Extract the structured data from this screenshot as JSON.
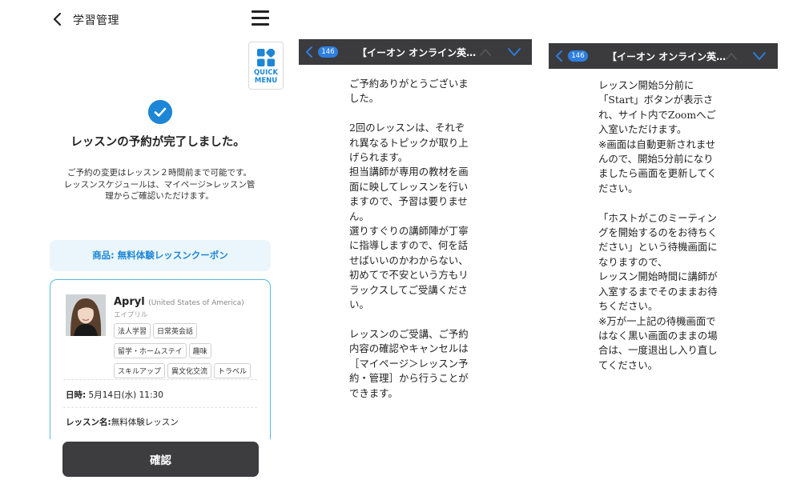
{
  "panel1": {
    "header": {
      "title": "学習管理"
    },
    "quick_menu": {
      "label_line1": "QUICK",
      "label_line2": "MENU"
    },
    "heading": "レッスンの予約が完了しました。",
    "notice_line1": "ご予約の変更はレッスン２時間前まで可能です。",
    "notice_line2": "レッスンスケジュールは、マイページ>レッスン管",
    "notice_line3": "理からご確認いただけます。",
    "coupon": "商品: 無料体験レッスンクーポン",
    "teacher": {
      "name": "Apryl",
      "country": "(United States of America)",
      "kana": "エイプリル",
      "tags": [
        "法人学習",
        "日常英会話",
        "留学・ホームステイ",
        "趣味",
        "スキルアップ",
        "異文化交流",
        "トラベル"
      ]
    },
    "datetime_label": "日時:",
    "datetime_value": "5月14日(水) 11:30",
    "lesson_label": "レッスン名:",
    "lesson_value": "無料体験レッスン",
    "confirm_button": "確認"
  },
  "chat_header": {
    "badge": "146",
    "title": "【イーオン オンライン英…"
  },
  "panel2": {
    "message": "ご予約ありがとうございま\nした。\n\n2回のレッスンは、それぞ\nれ異なるトピックが取り上\nげられます。\n担当講師が専用の教材を画\n面に映してレッスンを行い\nますので、予習は要りませ\nん。\n選りすぐりの講師陣が丁寧\nに指導しますので、何を話\nせばいいのかわからない、\n初めてで不安という方もリ\nラックスしてご受講くださ\nい。\n\nレッスンのご受講、ご予約\n内容の確認やキャンセルは\n［マイページ＞レッスン予\n約・管理］から行うことが\nできます。"
  },
  "panel3": {
    "message": "レッスン開始5分前に\n「Start」ボタンが表示さ\nれ、サイト内でZoomへご\n入室いただけます。\n※画面は自動更新されませ\nんので、開始5分前になり\nましたら画面を更新してく\nださい。\n\n「ホストがこのミーティン\nグを開始するのをお待ちく\nださい」という待機画面に\nなりますので、\nレッスン開始時間に講師が\n入室するまでそのままお待\nちください。\n※万が一上記の待機画面で\nはなく黒い画面のままの場\n合は、一度退出し入り直し\nてください。"
  },
  "colors": {
    "accent": "#1e86d6",
    "coupon_bg": "#eaf6fc",
    "card_border": "#5bb8e3",
    "button_dark": "#3d3d40",
    "chat_header": "#3b3b3d",
    "badge": "#2e7fe0"
  },
  "icons": {
    "back": "chevron-left-icon",
    "menu": "hamburger-icon",
    "quick": "grid-icon",
    "check": "check-circle-icon",
    "up": "chevron-up-icon",
    "down": "chevron-down-icon"
  }
}
